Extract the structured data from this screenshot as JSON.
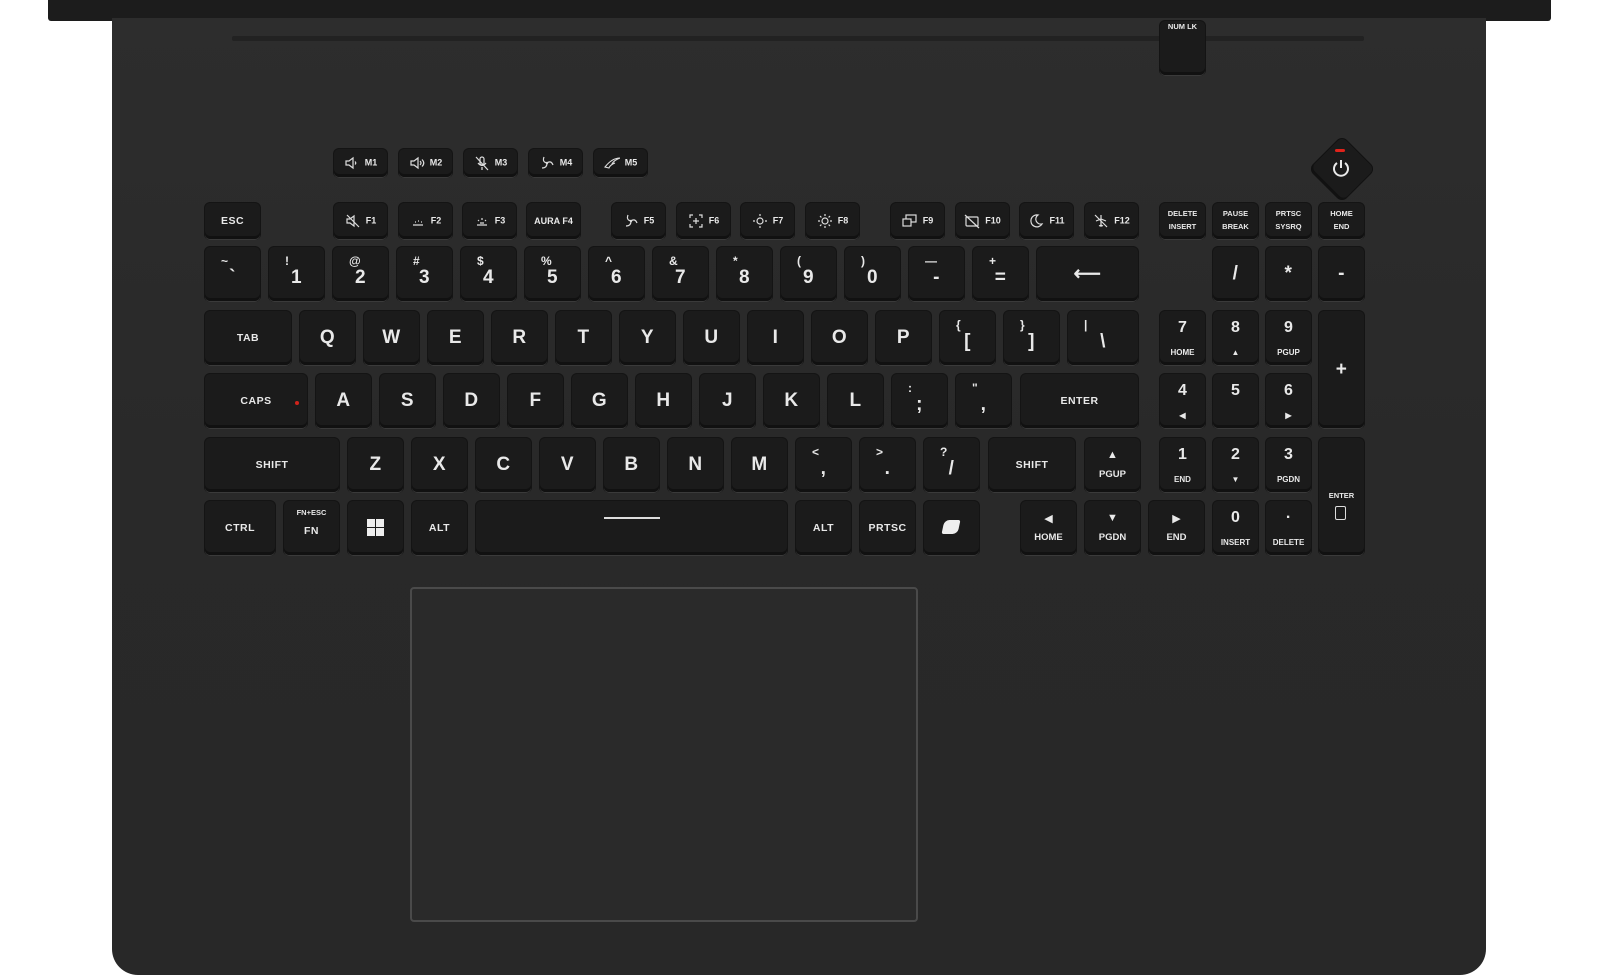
{
  "colors": {
    "deck": "#2b2b2b",
    "key": "#1b1b1b",
    "legend": "#e9e9e9",
    "power_led": "#e0231b",
    "caps_led": "#d0231b"
  },
  "macro_keys": [
    {
      "name": "key-m1",
      "label": "M1",
      "icon": "volume-down-icon"
    },
    {
      "name": "key-m2",
      "label": "M2",
      "icon": "volume-up-icon"
    },
    {
      "name": "key-m3",
      "label": "M3",
      "icon": "mic-mute-icon"
    },
    {
      "name": "key-m4",
      "label": "M4",
      "icon": "fan-icon"
    },
    {
      "name": "key-m5",
      "label": "M5",
      "icon": "rog-logo-icon"
    }
  ],
  "function_row": {
    "esc": "ESC",
    "keys": [
      {
        "name": "key-f1",
        "label": "F1",
        "icon": "mute-icon"
      },
      {
        "name": "key-f2",
        "label": "F2",
        "icon": "kbd-backlight-down-icon"
      },
      {
        "name": "key-f3",
        "label": "F3",
        "icon": "kbd-backlight-up-icon"
      },
      {
        "name": "key-f4",
        "label": "AURA F4",
        "icon": ""
      },
      {
        "name": "key-f5",
        "label": "F5",
        "icon": "fan-icon"
      },
      {
        "name": "key-f6",
        "label": "F6",
        "icon": "screenshot-icon"
      },
      {
        "name": "key-f7",
        "label": "F7",
        "icon": "brightness-down-icon"
      },
      {
        "name": "key-f8",
        "label": "F8",
        "icon": "brightness-up-icon"
      },
      {
        "name": "key-f9",
        "label": "F9",
        "icon": "display-switch-icon"
      },
      {
        "name": "key-f10",
        "label": "F10",
        "icon": "touchpad-off-icon"
      },
      {
        "name": "key-f11",
        "label": "F11",
        "icon": "sleep-icon"
      },
      {
        "name": "key-f12",
        "label": "F12",
        "icon": "airplane-mode-icon"
      }
    ],
    "extra": [
      {
        "name": "key-delete-insert",
        "top": "DELETE",
        "bottom": "INSERT"
      },
      {
        "name": "key-pause-break",
        "top": "PAUSE",
        "bottom": "BREAK"
      },
      {
        "name": "key-prtsc-sysrq",
        "top": "PRTSC",
        "bottom": "SYSRQ"
      },
      {
        "name": "key-home-end",
        "top": "HOME",
        "bottom": "END"
      }
    ]
  },
  "number_row": [
    {
      "name": "key-backtick",
      "main": "`",
      "shift": "~"
    },
    {
      "name": "key-1",
      "main": "1",
      "shift": "!"
    },
    {
      "name": "key-2",
      "main": "2",
      "shift": "@"
    },
    {
      "name": "key-3",
      "main": "3",
      "shift": "#"
    },
    {
      "name": "key-4",
      "main": "4",
      "shift": "$"
    },
    {
      "name": "key-5",
      "main": "5",
      "shift": "%"
    },
    {
      "name": "key-6",
      "main": "6",
      "shift": "^"
    },
    {
      "name": "key-7",
      "main": "7",
      "shift": "&"
    },
    {
      "name": "key-8",
      "main": "8",
      "shift": "*"
    },
    {
      "name": "key-9",
      "main": "9",
      "shift": "("
    },
    {
      "name": "key-0",
      "main": "0",
      "shift": ")"
    },
    {
      "name": "key-minus",
      "main": "-",
      "shift": "—"
    },
    {
      "name": "key-equals",
      "main": "=",
      "shift": "+"
    }
  ],
  "backspace": "⟵",
  "top_row": [
    "Q",
    "W",
    "E",
    "R",
    "T",
    "Y",
    "U",
    "I",
    "O",
    "P"
  ],
  "top_row_brackets": [
    {
      "name": "key-left-bracket",
      "main": "[",
      "shift": "{"
    },
    {
      "name": "key-right-bracket",
      "main": "]",
      "shift": "}"
    },
    {
      "name": "key-backslash",
      "main": "\\",
      "shift": "|"
    }
  ],
  "home_row": [
    "A",
    "S",
    "D",
    "F",
    "G",
    "H",
    "J",
    "K",
    "L"
  ],
  "home_row_punct": [
    {
      "name": "key-semicolon",
      "main": ";",
      "shift": ":"
    },
    {
      "name": "key-quote",
      "main": ",",
      "shift": "\""
    }
  ],
  "bottom_row": [
    "Z",
    "X",
    "C",
    "V",
    "B",
    "N",
    "M"
  ],
  "bottom_row_punct": [
    {
      "name": "key-comma",
      "main": ",",
      "shift": "<"
    },
    {
      "name": "key-period",
      "main": ".",
      "shift": ">"
    },
    {
      "name": "key-slash",
      "main": "/",
      "shift": "?"
    }
  ],
  "mods": {
    "tab": "TAB",
    "caps": "CAPS",
    "enter": "ENTER",
    "shift_left": "SHIFT",
    "shift_right": "SHIFT",
    "ctrl": "CTRL",
    "fn_top": "FN+ESC",
    "fn": "FN",
    "alt_left": "ALT",
    "alt_right": "ALT",
    "prtsc": "PRTSC"
  },
  "arrows": {
    "pgup": {
      "glyph": "▲",
      "label": "PGUP"
    },
    "home": {
      "glyph": "◀",
      "label": "HOME"
    },
    "pgdn": {
      "glyph": "▼",
      "label": "PGDN"
    },
    "end": {
      "glyph": "▶",
      "label": "END"
    }
  },
  "numpad": {
    "numlk": "NUM LK",
    "slash": "/",
    "star": "*",
    "minus": "-",
    "plus": "+",
    "enter": "ENTER",
    "keys": [
      {
        "name": "numpad-7",
        "top": "7",
        "bottom": "HOME"
      },
      {
        "name": "numpad-8",
        "top": "8",
        "bottom": "▲"
      },
      {
        "name": "numpad-9",
        "top": "9",
        "bottom": "PGUP"
      },
      {
        "name": "numpad-4",
        "top": "4",
        "bottom": "◀"
      },
      {
        "name": "numpad-5",
        "top": "5",
        "bottom": ""
      },
      {
        "name": "numpad-6",
        "top": "6",
        "bottom": "▶"
      },
      {
        "name": "numpad-1",
        "top": "1",
        "bottom": "END"
      },
      {
        "name": "numpad-2",
        "top": "2",
        "bottom": "▼"
      },
      {
        "name": "numpad-3",
        "top": "3",
        "bottom": "PGDN"
      },
      {
        "name": "numpad-0",
        "top": "0",
        "bottom": "INSERT"
      },
      {
        "name": "numpad-dot",
        "top": "·",
        "bottom": "DELETE"
      }
    ]
  }
}
